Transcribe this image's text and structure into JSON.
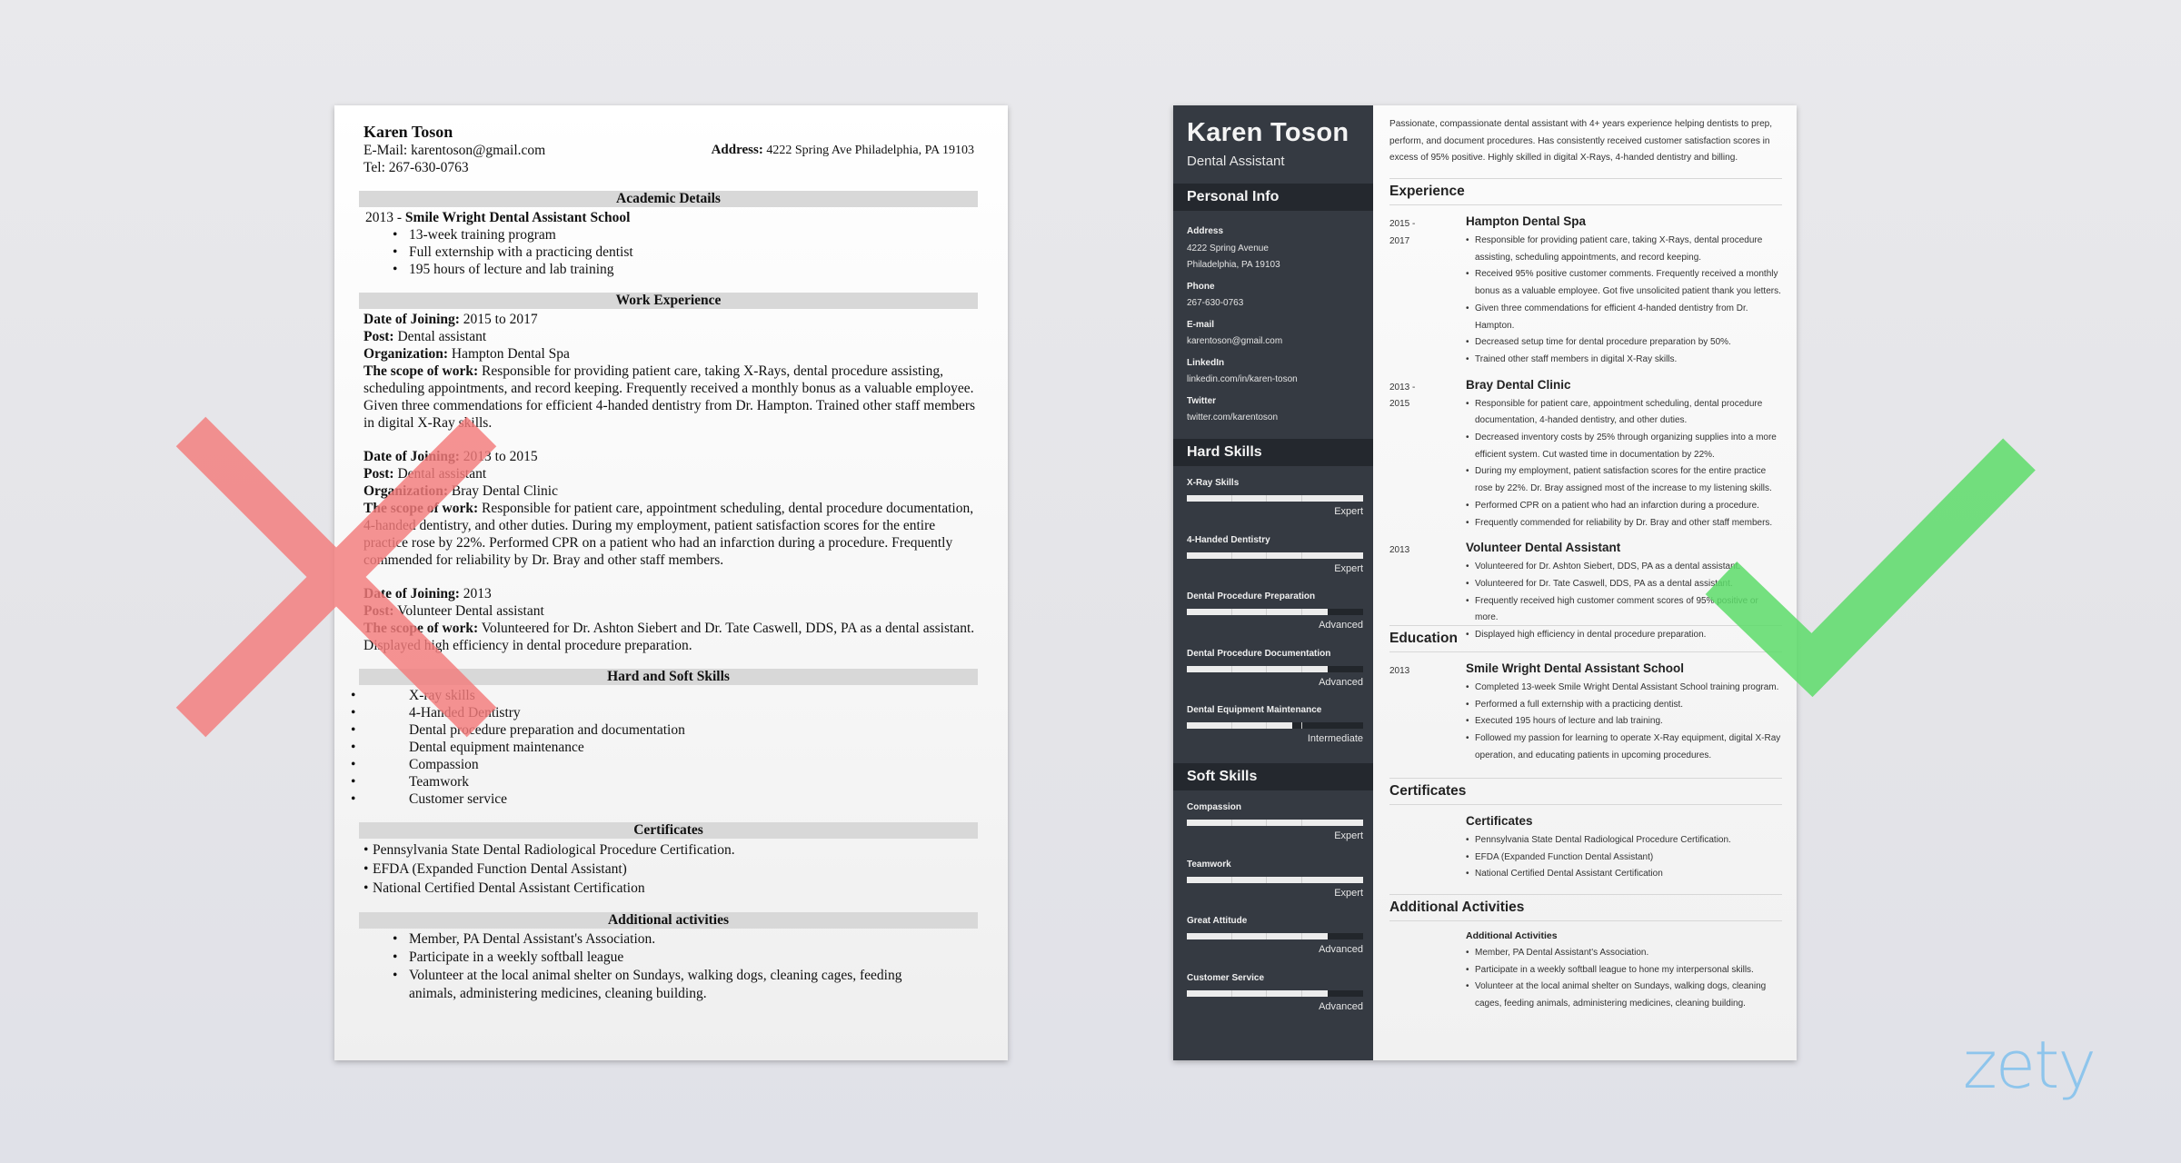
{
  "left_resume": {
    "name": "Karen Toson",
    "email_line": "E-Mail: karentoson@gmail.com",
    "tel_line": "Tel: 267-630-0763",
    "address_label": "Address:",
    "address_value": "4222 Spring Ave Philadelphia, PA 19103",
    "sections": {
      "academic": "Academic Details",
      "work": "Work Experience",
      "skills": "Hard and Soft Skills",
      "certs": "Certificates",
      "activities": "Additional activities"
    },
    "education": {
      "year_prefix": "2013 -",
      "school": "Smile Wright Dental Assistant School",
      "bullets": [
        "13-week training program",
        "Full externship with a practicing dentist",
        "195 hours of lecture and lab training"
      ]
    },
    "labels": {
      "date": "Date of Joining:",
      "post": "Post:",
      "org": "Organization:",
      "scope": "The scope of work:"
    },
    "jobs": [
      {
        "date": "2015 to 2017",
        "post": "Dental assistant",
        "org": "Hampton Dental Spa",
        "scope": "Responsible for providing patient care, taking X-Rays, dental procedure assisting, scheduling appointments, and record keeping. Frequently received a monthly bonus as a valuable employee. Given three commendations for efficient 4-handed dentistry from Dr. Hampton. Trained other staff members in digital X-Ray skills."
      },
      {
        "date": "2013 to 2015",
        "post": "Dental assistant",
        "org": "Bray Dental Clinic",
        "scope": "Responsible for patient care, appointment scheduling, dental procedure documentation, 4-handed dentistry, and other duties. During my employment, patient satisfaction scores for the entire practice rose by 22%. Performed CPR on a patient who had an infarction during a procedure. Frequently commended for reliability by Dr. Bray and other staff members."
      },
      {
        "date": "2013",
        "post": "Volunteer Dental assistant",
        "org": "",
        "scope": "Volunteered for Dr. Ashton Siebert and Dr. Tate Caswell, DDS, PA as a dental assistant. Displayed high efficiency in dental procedure preparation."
      }
    ],
    "skills": [
      "X-ray skills",
      "4-Handed Dentistry",
      "Dental procedure preparation and documentation",
      "Dental equipment maintenance",
      "Compassion",
      "Teamwork",
      "Customer service"
    ],
    "certificates": [
      "Pennsylvania State Dental Radiological Procedure Certification.",
      "EFDA (Expanded Function Dental Assistant)",
      "National Certified Dental Assistant Certification"
    ],
    "activities": [
      "Member, PA Dental Assistant's Association.",
      "Participate in a weekly softball league",
      "Volunteer at the local animal shelter on Sundays, walking dogs, cleaning cages, feeding animals, administering medicines, cleaning building."
    ]
  },
  "right_resume": {
    "name": "Karen Toson",
    "role": "Dental Assistant",
    "sidebar": {
      "personal_info_title": "Personal Info",
      "info": [
        {
          "label": "Address",
          "lines": [
            "4222 Spring Avenue",
            "Philadelphia, PA 19103"
          ]
        },
        {
          "label": "Phone",
          "lines": [
            "267-630-0763"
          ]
        },
        {
          "label": "E-mail",
          "lines": [
            "karentoson@gmail.com"
          ]
        },
        {
          "label": "LinkedIn",
          "lines": [
            "linkedin.com/in/karen-toson"
          ]
        },
        {
          "label": "Twitter",
          "lines": [
            "twitter.com/karentoson"
          ]
        }
      ],
      "hard_skills_title": "Hard Skills",
      "hard_skills": [
        {
          "name": "X-Ray Skills",
          "level": "Expert",
          "fraction": 1.0
        },
        {
          "name": "4-Handed Dentistry",
          "level": "Expert",
          "fraction": 1.0
        },
        {
          "name": "Dental Procedure Preparation",
          "level": "Advanced",
          "fraction": 0.8
        },
        {
          "name": "Dental Procedure Documentation",
          "level": "Advanced",
          "fraction": 0.8
        },
        {
          "name": "Dental Equipment Maintenance",
          "level": "Intermediate",
          "fraction": 0.6
        }
      ],
      "soft_skills_title": "Soft Skills",
      "soft_skills": [
        {
          "name": "Compassion",
          "level": "Expert",
          "fraction": 1.0
        },
        {
          "name": "Teamwork",
          "level": "Expert",
          "fraction": 1.0
        },
        {
          "name": "Great Attitude",
          "level": "Advanced",
          "fraction": 0.8
        },
        {
          "name": "Customer Service",
          "level": "Advanced",
          "fraction": 0.8
        }
      ]
    },
    "summary": "Passionate, compassionate dental assistant with 4+ years experience helping dentists to prep, perform, and document procedures. Has consistently received customer satisfaction scores in excess of 95% positive. Highly skilled in digital X-Rays, 4-handed dentistry and billing.",
    "experience_title": "Experience",
    "experience": [
      {
        "date": "2015 - 2017",
        "title": "Hampton Dental Spa",
        "bullets": [
          "Responsible for providing patient care, taking X-Rays, dental procedure assisting, scheduling appointments, and record keeping.",
          "Received 95% positive customer comments. Frequently received a monthly bonus as a valuable employee. Got five unsolicited patient thank you letters.",
          "Given three commendations for efficient 4-handed dentistry from Dr. Hampton.",
          "Decreased setup time for dental procedure preparation by 50%.",
          "Trained other staff members in digital X-Ray skills."
        ]
      },
      {
        "date": "2013 - 2015",
        "title": "Bray Dental Clinic",
        "bullets": [
          "Responsible for patient care, appointment scheduling, dental procedure documentation, 4-handed dentistry, and other duties.",
          "Decreased inventory costs by 25% through organizing supplies into a more efficient system. Cut wasted time in documentation by 22%.",
          "During my employment, patient satisfaction scores for the entire practice rose by 22%. Dr. Bray assigned most of the increase to my listening skills.",
          "Performed CPR on a patient who had an infarction during a procedure.",
          "Frequently commended for reliability by Dr. Bray and other staff members."
        ]
      },
      {
        "date": "2013",
        "title": "Volunteer Dental Assistant",
        "bullets": [
          "Volunteered for Dr. Ashton Siebert, DDS, PA as a dental assistant.",
          "Volunteered for Dr. Tate Caswell, DDS, PA as a dental assistant.",
          "Frequently received high customer comment scores of 95% positive or more.",
          "Displayed high efficiency in dental procedure preparation."
        ]
      }
    ],
    "education_title": "Education",
    "education": {
      "date": "2013",
      "title": "Smile Wright Dental Assistant School",
      "bullets": [
        "Completed 13-week Smile Wright Dental Assistant School training program.",
        "Performed a full externship with a practicing dentist.",
        "Executed 195 hours of lecture and lab training.",
        "Followed my passion for learning to operate X-Ray equipment, digital X-Ray operation, and educating patients in upcoming procedures."
      ]
    },
    "certificates_title": "Certificates",
    "certificates": {
      "title": "Certificates",
      "bullets": [
        "Pennsylvania State Dental Radiological Procedure Certification.",
        "EFDA (Expanded Function Dental Assistant)",
        "National Certified Dental Assistant Certification"
      ]
    },
    "activities_title": "Additional Activities",
    "activities": {
      "title": "Additional Activities",
      "bullets": [
        "Member, PA Dental Assistant's Association.",
        "Participate in a weekly softball league to hone my interpersonal skills.",
        "Volunteer at the local animal shelter on Sundays, walking dogs, cleaning cages, feeding animals, administering medicines, cleaning building."
      ]
    }
  },
  "marks": {
    "bad_icon": "x-mark-icon",
    "good_icon": "check-mark-icon",
    "bad_color": "#f47c7c",
    "good_color": "#5ddc6a"
  },
  "brand": {
    "logo": "zety",
    "color": "#8ec5ec"
  }
}
